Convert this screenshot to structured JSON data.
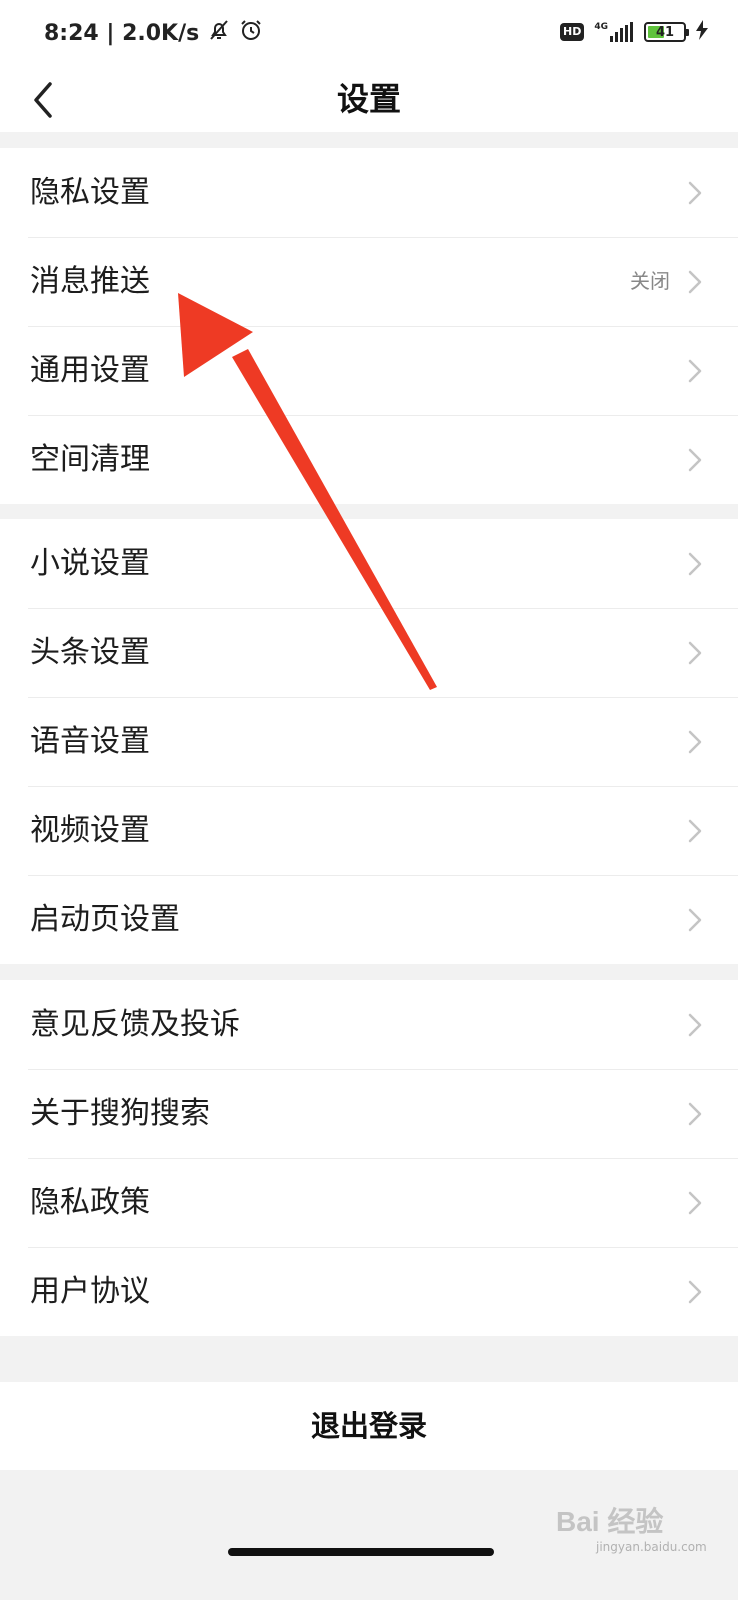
{
  "status_bar": {
    "time_speed": "8:24 | 2.0K/s",
    "hd_badge": "HD",
    "network": "4G",
    "battery_level": "41",
    "battery_color": "#5fc33c"
  },
  "header": {
    "title": "设置"
  },
  "groups": [
    {
      "items": [
        {
          "label": "隐私设置"
        },
        {
          "label": "消息推送",
          "value": "关闭"
        },
        {
          "label": "通用设置"
        },
        {
          "label": "空间清理"
        }
      ]
    },
    {
      "items": [
        {
          "label": "小说设置"
        },
        {
          "label": "头条设置"
        },
        {
          "label": "语音设置"
        },
        {
          "label": "视频设置"
        },
        {
          "label": "启动页设置"
        }
      ]
    },
    {
      "items": [
        {
          "label": "意见反馈及投诉"
        },
        {
          "label": "关于搜狗搜索"
        },
        {
          "label": "隐私政策"
        },
        {
          "label": "用户协议"
        }
      ]
    }
  ],
  "logout_label": "退出登录",
  "watermark": {
    "text": "Bai 经验",
    "sub": "jingyan.baidu.com"
  },
  "annotation_arrow": {
    "color": "#ee3a24"
  }
}
